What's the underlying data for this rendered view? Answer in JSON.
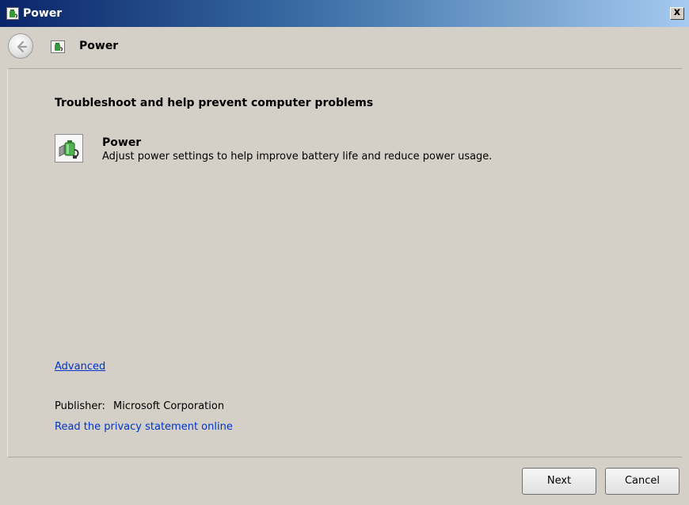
{
  "window": {
    "title": "Power",
    "close_label": "x"
  },
  "nav": {
    "title": "Power"
  },
  "main": {
    "heading": "Troubleshoot and help prevent computer problems",
    "item": {
      "title": "Power",
      "description": "Adjust power settings to help improve battery life and reduce power usage."
    },
    "advanced_link": "Advanced",
    "publisher_label": "Publisher:",
    "publisher_name": "Microsoft Corporation",
    "privacy_link": "Read the privacy statement online"
  },
  "buttons": {
    "next": "Next",
    "cancel": "Cancel"
  },
  "icons": {
    "title": "power-troubleshooter-icon",
    "back": "back-arrow-icon",
    "nav": "power-troubleshooter-icon",
    "item": "power-plug-battery-icon"
  },
  "colors": {
    "title_bar_start": "#0a246a",
    "title_bar_end": "#a6caf0",
    "window_bg": "#d4d0c8",
    "link": "#0033cc"
  }
}
